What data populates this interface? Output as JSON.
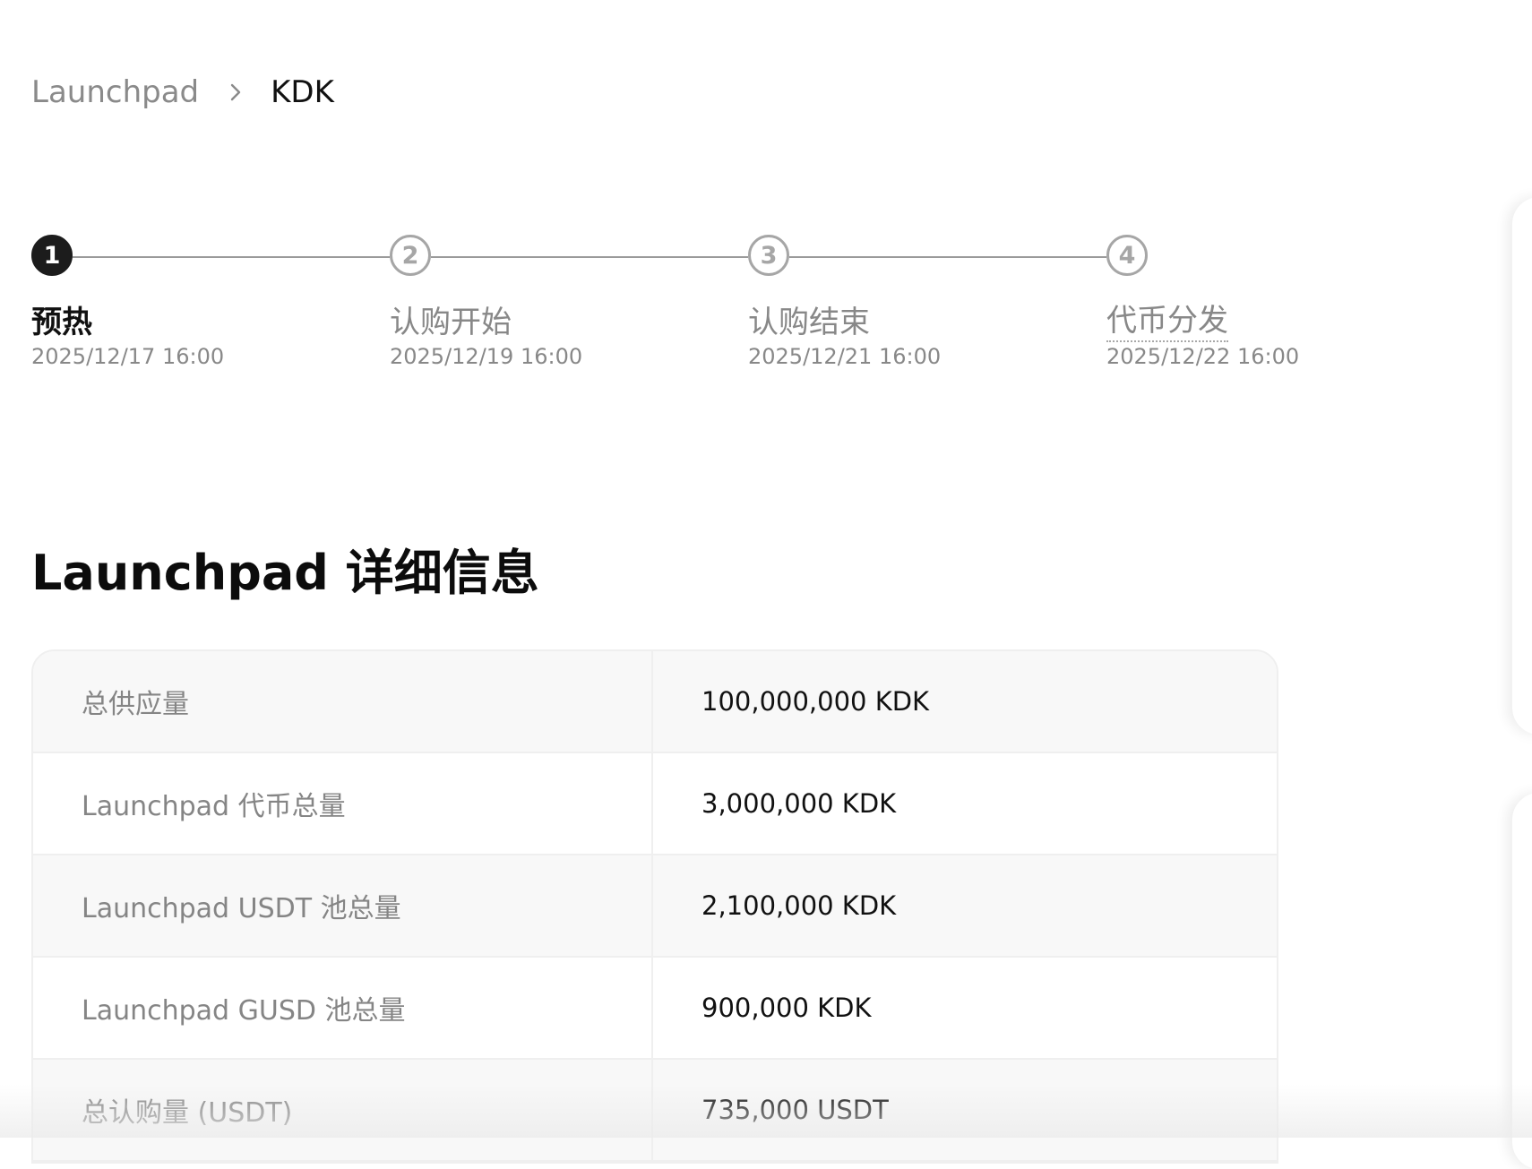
{
  "breadcrumb": {
    "root": "Launchpad",
    "current": "KDK"
  },
  "stepper": {
    "active_step": 1,
    "steps": [
      {
        "number": "1",
        "title": "预热",
        "date": "2025/12/17 16:00"
      },
      {
        "number": "2",
        "title": "认购开始",
        "date": "2025/12/19 16:00"
      },
      {
        "number": "3",
        "title": "认购结束",
        "date": "2025/12/21 16:00"
      },
      {
        "number": "4",
        "title": "代币分发",
        "date": "2025/12/22 16:00"
      }
    ]
  },
  "details": {
    "title": "Launchpad 详细信息",
    "rows": [
      {
        "label": "总供应量",
        "value": "100,000,000 KDK"
      },
      {
        "label": "Launchpad 代币总量",
        "value": "3,000,000 KDK"
      },
      {
        "label": "Launchpad USDT 池总量",
        "value": "2,100,000 KDK"
      },
      {
        "label": "Launchpad GUSD 池总量",
        "value": "900,000 KDK"
      },
      {
        "label": "总认购量 (USDT)",
        "value": "735,000 USDT"
      }
    ]
  },
  "icons": {
    "breadcrumb_separator": "chevron-right-icon"
  },
  "colors": {
    "active_step": "#1c1c1c",
    "inactive_step": "#a6a6a6",
    "muted_text": "#888888",
    "row_shade": "#f8f8f8"
  }
}
